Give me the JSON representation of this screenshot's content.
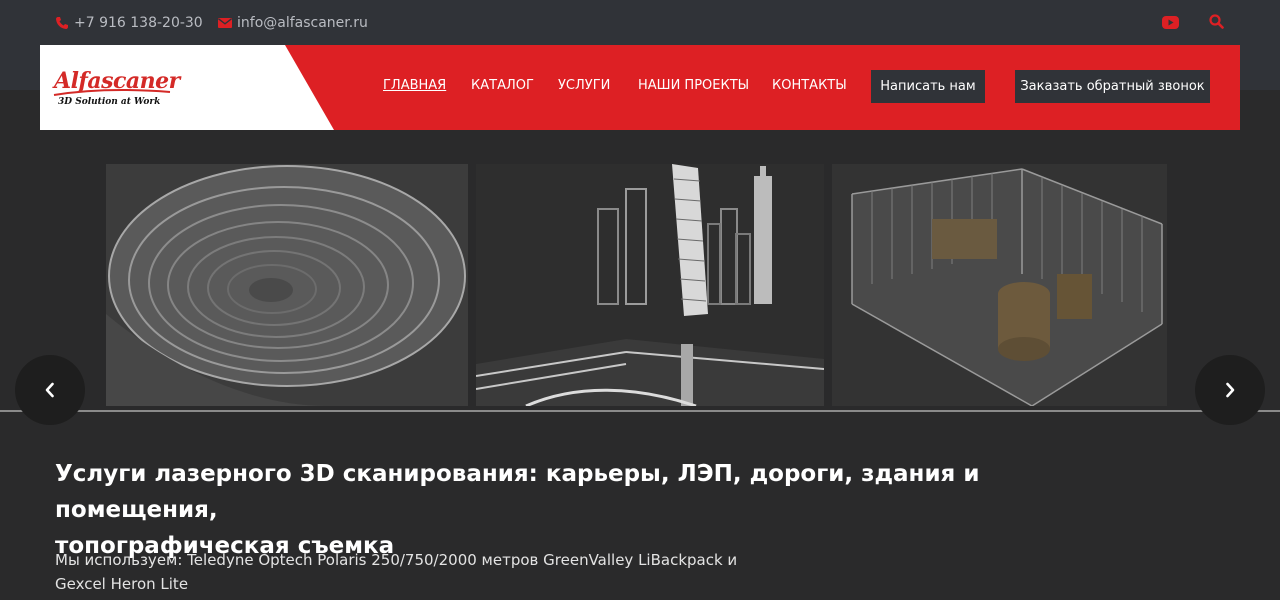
{
  "topbar": {
    "phone": "+7 916 138-20-30",
    "email": "info@alfascaner.ru",
    "icons": [
      "phone-icon",
      "envelope-icon",
      "youtube-icon",
      "search-icon"
    ]
  },
  "logo": {
    "title": "Alfascaner",
    "subtitle": "3D Solution at Work"
  },
  "nav": {
    "items": [
      {
        "label": "ГЛАВНАЯ",
        "active": true
      },
      {
        "label": "КАТАЛОГ",
        "active": false
      },
      {
        "label": "УСЛУГИ",
        "active": false
      },
      {
        "label": "НАШИ ПРОЕКТЫ",
        "active": false
      },
      {
        "label": "КОНТАКТЫ",
        "active": false
      }
    ],
    "write_button": "Написать нам",
    "callback_button": "Заказать обратный звонок"
  },
  "slider": {
    "slides": [
      "quarry-scan",
      "city-towers-scan",
      "fenced-yard-scan"
    ],
    "prev_icon": "chevron-left-icon",
    "next_icon": "chevron-right-icon"
  },
  "content": {
    "headline_line1": "Услуги лазерного 3D сканирования: карьеры, ЛЭП, дороги, здания и помещения,",
    "headline_line2": "топографическая съемка",
    "desc_line1": "Мы используем: Teledyne Optech Polaris 250/750/2000 метров GreenValley LiBackpack и",
    "desc_line2": "Gexcel Heron Lite"
  },
  "colors": {
    "accent_red": "#dd2024",
    "topbar_bg": "#303338",
    "page_bg": "#2a2a2b"
  }
}
